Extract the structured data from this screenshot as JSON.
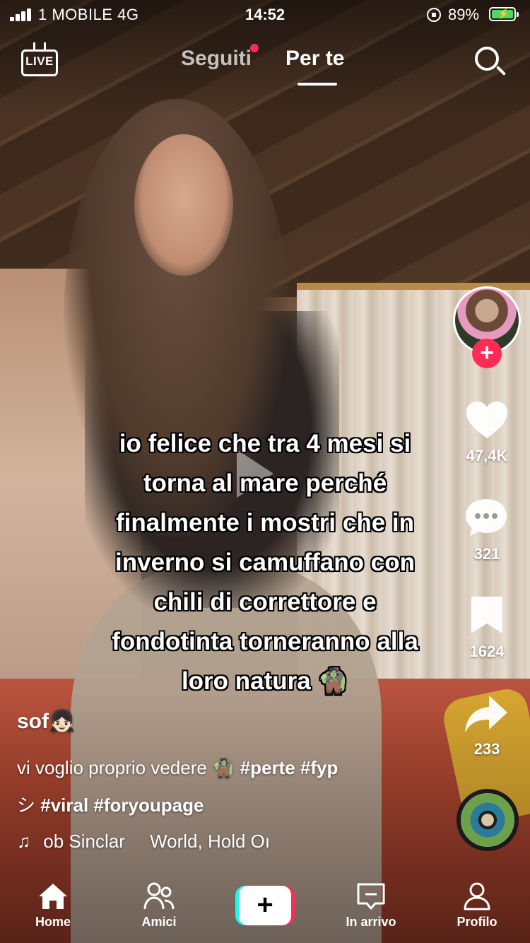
{
  "status_bar": {
    "carrier": "1 MOBILE  4G",
    "time": "14:52",
    "battery": "89%"
  },
  "top_nav": {
    "live_label": "LIVE",
    "tabs": [
      {
        "label": "Seguiti",
        "active": false,
        "has_dot": true
      },
      {
        "label": "Per te",
        "active": true
      }
    ]
  },
  "video": {
    "overlay_lines": [
      "io felice che tra 4 mesi si",
      "torna al mare perché",
      "finalmente i mostri che in",
      "inverno si camuffano con",
      "chili di correttore e",
      "fondotinta torneranno alla",
      "loro natura 🧌"
    ],
    "author": "sof👧🏻",
    "description_line1": "vi voglio proprio vedere 🧌 ",
    "description_tags1": "#perte #fyp",
    "description_line2_prefix": "シ ",
    "description_tags2": "#viral #foryoupage",
    "music_text": "ob Sinclar",
    "music_text2": "World, Hold Oı"
  },
  "right_rail": {
    "likes": "47,4K",
    "comments": "321",
    "saves": "1624",
    "shares": "233",
    "follow_symbol": "+"
  },
  "tab_bar": {
    "home": "Home",
    "friends": "Amici",
    "create_symbol": "+",
    "inbox": "In arrivo",
    "profile": "Profilo"
  },
  "icons": {
    "live": "live-tv-icon",
    "search": "search-icon",
    "heart": "heart-icon",
    "comment": "comment-icon",
    "bookmark": "bookmark-icon",
    "share": "share-icon",
    "music": "music-note-icon",
    "home": "home-icon",
    "friends": "friends-icon",
    "inbox": "inbox-icon",
    "profile": "profile-icon"
  },
  "colors": {
    "accent": "#fe2c55",
    "cyan": "#25f4ee",
    "battery_charging": "#4cd964"
  }
}
